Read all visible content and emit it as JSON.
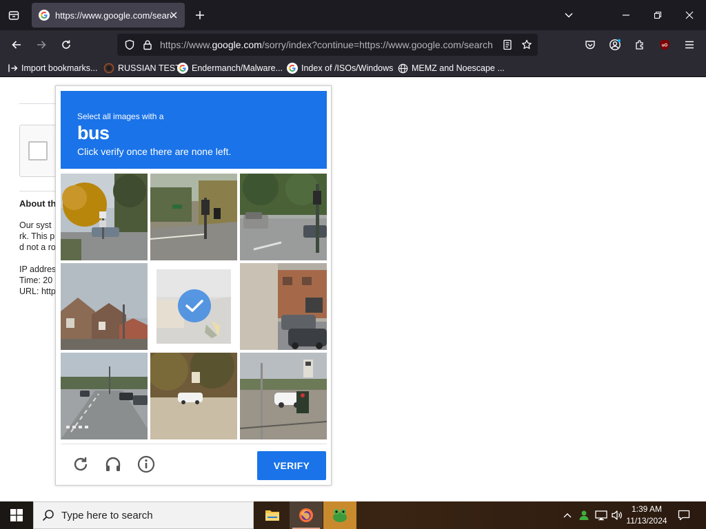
{
  "browser": {
    "tab_title": "https://www.google.com/search",
    "url_display": {
      "prefix": "https://www.",
      "domain": "google.com",
      "rest": "/sorry/index?continue=https://www.google.com/search"
    },
    "bookmarks": [
      {
        "label": "Import bookmarks...",
        "icon": "import-icon"
      },
      {
        "label": "RUSSIAN TEST",
        "icon": "bookmark-favicon"
      },
      {
        "label": "Endermanch/Malware...",
        "icon": "google-icon"
      },
      {
        "label": "Index of /ISOs/Windows",
        "icon": "google-icon"
      },
      {
        "label": "MEMZ and Noescape ...",
        "icon": "globe-icon"
      }
    ]
  },
  "page": {
    "heading": "About th",
    "lines": [
      "Our syst",
      "rk. This p",
      "d not a ro",
      "IP addres",
      "Time: 20",
      "URL: http"
    ]
  },
  "captcha": {
    "instruction": "Select all images with a",
    "target": "bus",
    "subtext": "Click verify once there are none left.",
    "verify_label": "VERIFY",
    "header_color": "#1a73e8",
    "selected_tiles": [
      4
    ]
  },
  "taskbar": {
    "search_placeholder": "Type here to search",
    "time": "1:39 AM",
    "date": "11/13/2024"
  }
}
